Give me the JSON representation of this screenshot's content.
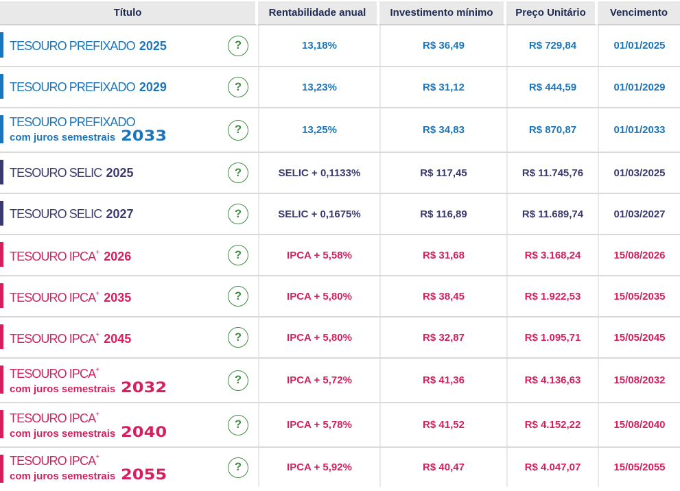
{
  "header": {
    "columns": [
      "Título",
      "Rentabilidade anual",
      "Investimento mínimo",
      "Preço Unitário",
      "Vencimento"
    ]
  },
  "colors": {
    "prefixado": "#1b75bb",
    "selic": "#3a3a6e",
    "ipca": "#d51f5f",
    "help_green": "#3c8c40",
    "header_text": "#1e2a52"
  },
  "help_icon": "?",
  "rows": [
    {
      "type": "prefixado",
      "title": "TESOURO PREFIXADO",
      "sup": "",
      "sub": "",
      "year": "2025",
      "rate": "13,18%",
      "min": "R$ 36,49",
      "price": "R$ 729,84",
      "due": "01/01/2025"
    },
    {
      "type": "prefixado",
      "title": "TESOURO PREFIXADO",
      "sup": "",
      "sub": "",
      "year": "2029",
      "rate": "13,23%",
      "min": "R$ 31,12",
      "price": "R$ 444,59",
      "due": "01/01/2029"
    },
    {
      "type": "prefixado",
      "title": "TESOURO PREFIXADO",
      "sup": "",
      "sub": "com juros semestrais",
      "year": "2033",
      "rate": "13,25%",
      "min": "R$ 34,83",
      "price": "R$ 870,87",
      "due": "01/01/2033"
    },
    {
      "type": "selic",
      "title": "TESOURO SELIC",
      "sup": "",
      "sub": "",
      "year": "2025",
      "rate": "SELIC + 0,1133%",
      "min": "R$ 117,45",
      "price": "R$ 11.745,76",
      "due": "01/03/2025"
    },
    {
      "type": "selic",
      "title": "TESOURO SELIC",
      "sup": "",
      "sub": "",
      "year": "2027",
      "rate": "SELIC + 0,1675%",
      "min": "R$ 116,89",
      "price": "R$ 11.689,74",
      "due": "01/03/2027"
    },
    {
      "type": "ipca",
      "title": "TESOURO IPCA",
      "sup": "+",
      "sub": "",
      "year": "2026",
      "rate": "IPCA + 5,58%",
      "min": "R$ 31,68",
      "price": "R$ 3.168,24",
      "due": "15/08/2026"
    },
    {
      "type": "ipca",
      "title": "TESOURO IPCA",
      "sup": "+",
      "sub": "",
      "year": "2035",
      "rate": "IPCA + 5,80%",
      "min": "R$ 38,45",
      "price": "R$ 1.922,53",
      "due": "15/05/2035"
    },
    {
      "type": "ipca",
      "title": "TESOURO IPCA",
      "sup": "+",
      "sub": "",
      "year": "2045",
      "rate": "IPCA + 5,80%",
      "min": "R$ 32,87",
      "price": "R$ 1.095,71",
      "due": "15/05/2045"
    },
    {
      "type": "ipca",
      "title": "TESOURO IPCA",
      "sup": "+",
      "sub": "com juros semestrais",
      "year": "2032",
      "rate": "IPCA + 5,72%",
      "min": "R$ 41,36",
      "price": "R$ 4.136,63",
      "due": "15/08/2032"
    },
    {
      "type": "ipca",
      "title": "TESOURO IPCA",
      "sup": "+",
      "sub": "com juros semestrais",
      "year": "2040",
      "rate": "IPCA + 5,78%",
      "min": "R$ 41,52",
      "price": "R$ 4.152,22",
      "due": "15/08/2040"
    },
    {
      "type": "ipca",
      "title": "TESOURO IPCA",
      "sup": "+",
      "sub": "com juros semestrais",
      "year": "2055",
      "rate": "IPCA + 5,92%",
      "min": "R$ 40,47",
      "price": "R$ 4.047,07",
      "due": "15/05/2055"
    }
  ]
}
